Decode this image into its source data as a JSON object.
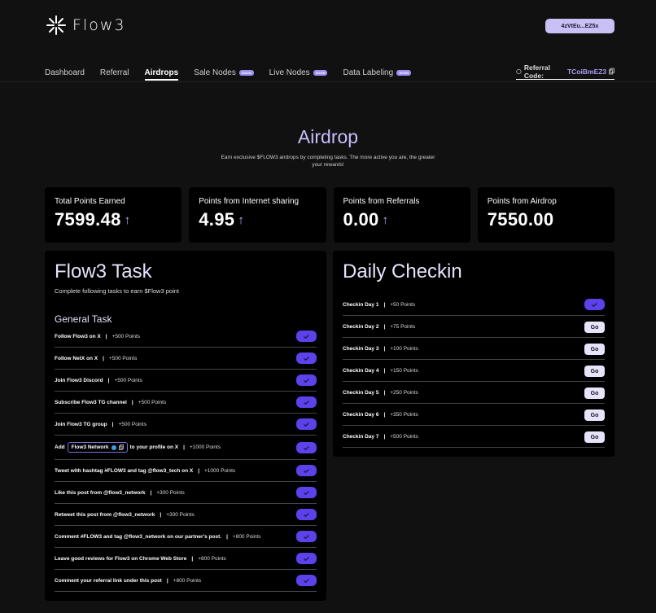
{
  "header": {
    "brand": "Flow3",
    "wallet": "4zVtEu...EZ5x"
  },
  "nav": {
    "items": [
      {
        "label": "Dashboard",
        "badge": "",
        "active": false
      },
      {
        "label": "Referral",
        "badge": "",
        "active": false
      },
      {
        "label": "Airdrops",
        "badge": "",
        "active": true
      },
      {
        "label": "Sale Nodes",
        "badge": "SOON",
        "active": false
      },
      {
        "label": "Live Nodes",
        "badge": "SOON",
        "active": false
      },
      {
        "label": "Data Labeling",
        "badge": "SOON",
        "active": false
      }
    ],
    "referral_label": "Referral Code:",
    "referral_code": "TCoiBmEZ3"
  },
  "hero": {
    "title": "Airdrop",
    "subtitle": "Earn exclusive $FLOW3 airdrops by completing tasks. The more active you are, the greater your rewards!"
  },
  "stats": [
    {
      "label": "Total Points Earned",
      "value": "7599.48",
      "arrow": "↑"
    },
    {
      "label": "Points from Internet sharing",
      "value": "4.95",
      "arrow": "↑"
    },
    {
      "label": "Points from Referrals",
      "value": "0.00",
      "arrow": "↑"
    },
    {
      "label": "Points from Airdrop",
      "value": "7550.00",
      "arrow": ""
    }
  ],
  "tasks": {
    "title": "Flow3 Task",
    "subtitle": "Complete following tasks to earn $Flow3 point",
    "section": "General Task",
    "sep": "|",
    "items": [
      {
        "name": "Follow Flow3 on X",
        "points": "+500 Points",
        "done": true
      },
      {
        "name": "Follow NetX on X",
        "points": "+500 Points",
        "done": true
      },
      {
        "name": "Join Flow3 Discord",
        "points": "+500 Points",
        "done": true
      },
      {
        "name": "Subscribe Flow3 TG channel",
        "points": "+500 Points",
        "done": true
      },
      {
        "name": "Join Flow3 TG group",
        "points": "+500 Points",
        "done": true
      },
      {
        "name_pre": "Add",
        "chip": "Flow3 Network",
        "name_post": "to your profile on X",
        "points": "+1000 Points",
        "done": true
      },
      {
        "name": "Tweet with hashtag #FLOW3 and tag @flow3_tech on X",
        "points": "+1000 Points",
        "done": true
      },
      {
        "name": "Like this post from @flow3_network",
        "points": "+300 Points",
        "done": true
      },
      {
        "name": "Retweet this post from @flow3_network",
        "points": "+300 Points",
        "done": true
      },
      {
        "name": "Comment #FLOW3 and tag @flow3_network on our partner's post.",
        "points": "+800 Points",
        "done": true
      },
      {
        "name": "Leave good reviews for Flow3 on Chrome Web Store",
        "points": "+800 Points",
        "done": true
      },
      {
        "name": "Comment your referral link under this post",
        "points": "+800 Points",
        "done": true
      }
    ]
  },
  "checkin": {
    "title": "Daily Checkin",
    "sep": "|",
    "go_label": "Go",
    "items": [
      {
        "day": "Checkin Day 1",
        "points": "+50 Points",
        "done": true
      },
      {
        "day": "Checkin Day 2",
        "points": "+75 Points",
        "done": false
      },
      {
        "day": "Checkin Day 3",
        "points": "+100 Points",
        "done": false
      },
      {
        "day": "Checkin Day 4",
        "points": "+150 Points",
        "done": false
      },
      {
        "day": "Checkin Day 5",
        "points": "+250 Points",
        "done": false
      },
      {
        "day": "Checkin Day 6",
        "points": "+350 Points",
        "done": false
      },
      {
        "day": "Checkin Day 7",
        "points": "+500 Points",
        "done": false
      }
    ]
  },
  "colors": {
    "accent": "#5b42ea",
    "accent_light": "#c9c0f5",
    "background": "#111111",
    "card": "#000000"
  }
}
